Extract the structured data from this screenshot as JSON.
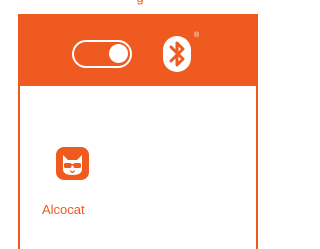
{
  "caption_fragment": "g",
  "status_bar": {
    "toggle_state": "on",
    "bluetooth_registered_mark": "®"
  },
  "app": {
    "label": "Alcocat",
    "icon": "cat-with-sunglasses-icon"
  },
  "colors": {
    "accent": "#ee5a1f",
    "background": "#ffffff"
  }
}
